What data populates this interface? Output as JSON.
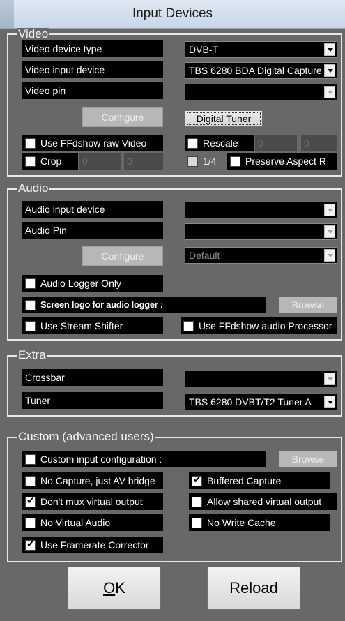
{
  "window": {
    "title": "Input Devices"
  },
  "video": {
    "group_title": "Video",
    "device_type_label": "Video device type",
    "device_type_value": "DVB-T",
    "input_device_label": "Video input device",
    "input_device_value": "TBS 6280 BDA Digital Capture",
    "pin_label": "Video pin",
    "pin_value": "",
    "configure_label": "Configure",
    "digital_tuner_label": "Digital Tuner",
    "ffdshow_raw_label": "Use FFdshow raw Video",
    "rescale_label": "Rescale",
    "rescale_w": "0",
    "rescale_h": "0",
    "crop_label": "Crop",
    "crop_a": "0",
    "crop_b": "0",
    "quarter_label": "1/4",
    "preserve_aspect_label": "Preserve Aspect R"
  },
  "audio": {
    "group_title": "Audio",
    "input_device_label": "Audio input device",
    "pin_label": "Audio Pin",
    "configure_label": "Configure",
    "default_value": "Default",
    "logger_only_label": "Audio Logger Only",
    "screen_logo_label": "Screen logo for audio logger :",
    "browse_label": "Browse",
    "stream_shifter_label": "Use Stream Shifter",
    "ffdshow_audio_label": "Use FFdshow audio Processor"
  },
  "extra": {
    "group_title": "Extra",
    "crossbar_label": "Crossbar",
    "crossbar_value": "",
    "tuner_label": "Tuner",
    "tuner_value": "TBS 6280 DVBT/T2 Tuner A"
  },
  "custom": {
    "group_title": "Custom (advanced users)",
    "custom_input_label": "Custom input configuration :",
    "browse_label": "Browse",
    "no_capture_label": "No Capture, just AV bridge",
    "buffered_capture_label": "Buffered Capture",
    "buffered_capture_checked": true,
    "dont_mux_label": "Don't mux virtual output",
    "dont_mux_checked": true,
    "allow_shared_label": "Allow shared virtual output",
    "no_virtual_audio_label": "No Virtual Audio",
    "no_write_cache_label": "No Write Cache",
    "framerate_corrector_label": "Use Framerate Corrector",
    "framerate_corrector_checked": true
  },
  "footer": {
    "ok_label": "OK",
    "reload_label": "Reload"
  }
}
